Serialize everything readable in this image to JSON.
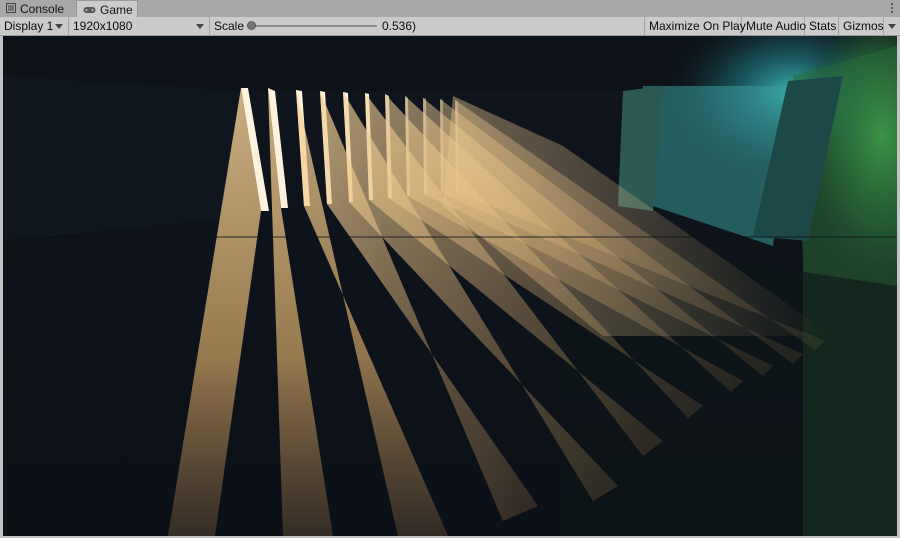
{
  "tabs": [
    {
      "label": "Console",
      "icon": "console-icon"
    },
    {
      "label": "Game",
      "icon": "gamepad-icon",
      "active": true
    }
  ],
  "toolbar": {
    "display": "Display 1",
    "resolution": "1920x1080",
    "scale_label": "Scale",
    "scale_value": "0.536)",
    "scale_level": 0.0,
    "maximize": "Maximize On Play",
    "mute": "Mute Audio",
    "stats": "Stats",
    "gizmos": "Gizmos"
  },
  "scene": {
    "description_colors": {
      "light": "#f6c98a",
      "teal": "#3aa7a8",
      "green": "#4fb04a",
      "dark": "#101620"
    }
  }
}
